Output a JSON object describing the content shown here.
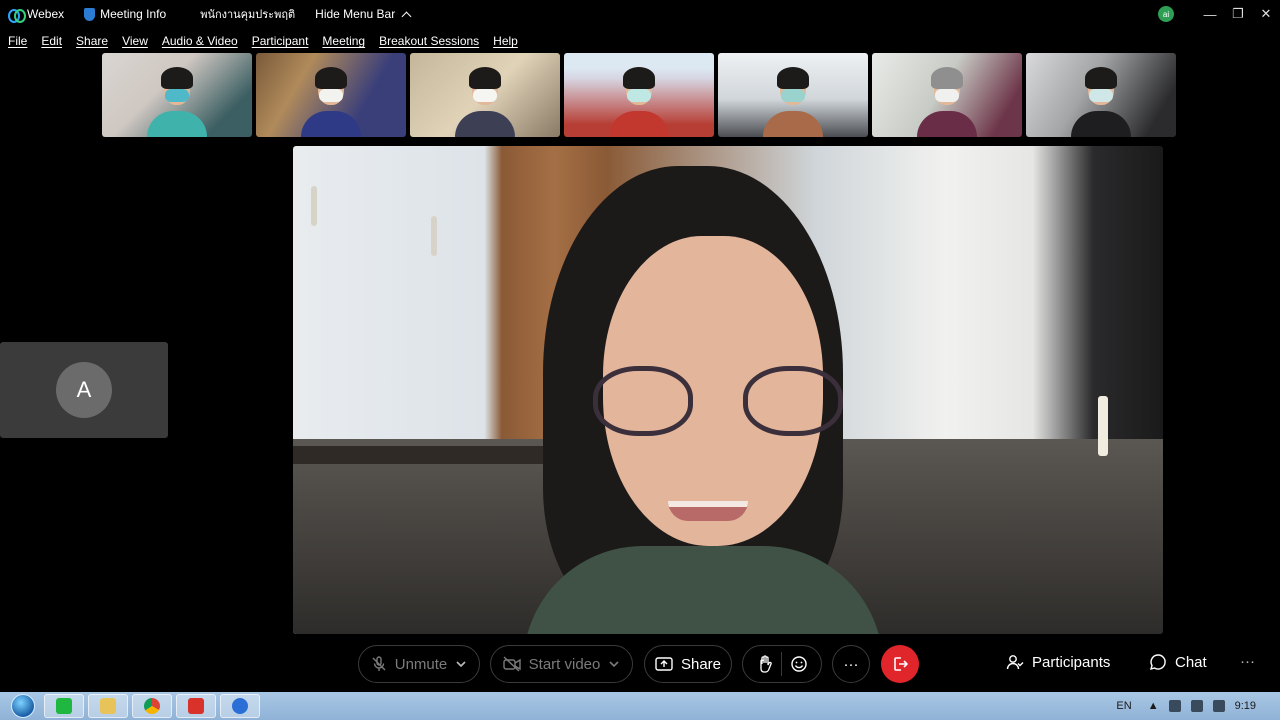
{
  "titlebar": {
    "app_name": "Webex",
    "meeting_info": "Meeting Info",
    "meeting_name": "พนักงานคุมประพฤติ",
    "hide_menu": "Hide Menu Bar",
    "user_initial": "ai"
  },
  "menu": {
    "items": [
      {
        "label": "File"
      },
      {
        "label": "Edit"
      },
      {
        "label": "Share"
      },
      {
        "label": "View"
      },
      {
        "label": "Audio & Video"
      },
      {
        "label": "Participant"
      },
      {
        "label": "Meeting"
      },
      {
        "label": "Breakout Sessions"
      },
      {
        "label": "Help"
      }
    ]
  },
  "self_view": {
    "initial": "A"
  },
  "controls": {
    "unmute": "Unmute",
    "start_video": "Start video",
    "share": "Share",
    "participants": "Participants",
    "chat": "Chat",
    "more": "···"
  },
  "taskbar": {
    "lang": "EN",
    "time": "9:19"
  },
  "colors": {
    "leave_button": "#e0252b",
    "taskbar": "#a9c7e5",
    "background": "#000000"
  }
}
